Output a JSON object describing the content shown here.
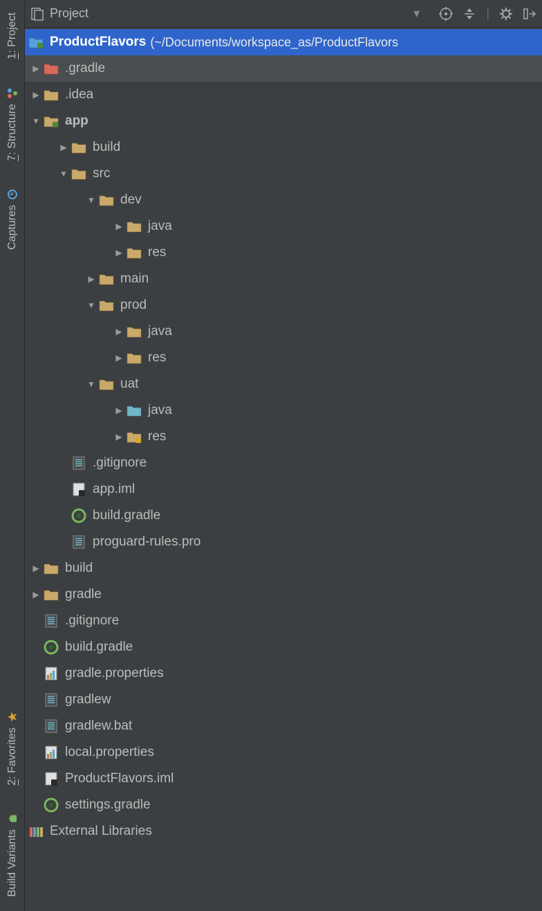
{
  "toolbar": {
    "title": "Project"
  },
  "rail": {
    "project": "1: Project",
    "structure": "7: Structure",
    "captures": "Captures",
    "favorites": "2: Favorites",
    "build_variants": "Build Variants"
  },
  "tree": {
    "root": {
      "name": "ProductFlavors",
      "path": "(~/Documents/workspace_as/ProductFlavors"
    },
    "items": {
      "gradle_dot": ".gradle",
      "idea": ".idea",
      "app": "app",
      "app_build": "build",
      "app_src": "src",
      "dev": "dev",
      "dev_java": "java",
      "dev_res": "res",
      "main": "main",
      "prod": "prod",
      "prod_java": "java",
      "prod_res": "res",
      "uat": "uat",
      "uat_java": "java",
      "uat_res": "res",
      "gitignore": ".gitignore",
      "app_iml": "app.iml",
      "build_gradle": "build.gradle",
      "proguard": "proguard-rules.pro",
      "build": "build",
      "gradle": "gradle",
      "root_gitignore": ".gitignore",
      "root_build_gradle": "build.gradle",
      "gradle_props": "gradle.properties",
      "gradlew": "gradlew",
      "gradlew_bat": "gradlew.bat",
      "local_props": "local.properties",
      "product_iml": "ProductFlavors.iml",
      "settings_gradle": "settings.gradle",
      "ext_libs": "External Libraries"
    }
  }
}
